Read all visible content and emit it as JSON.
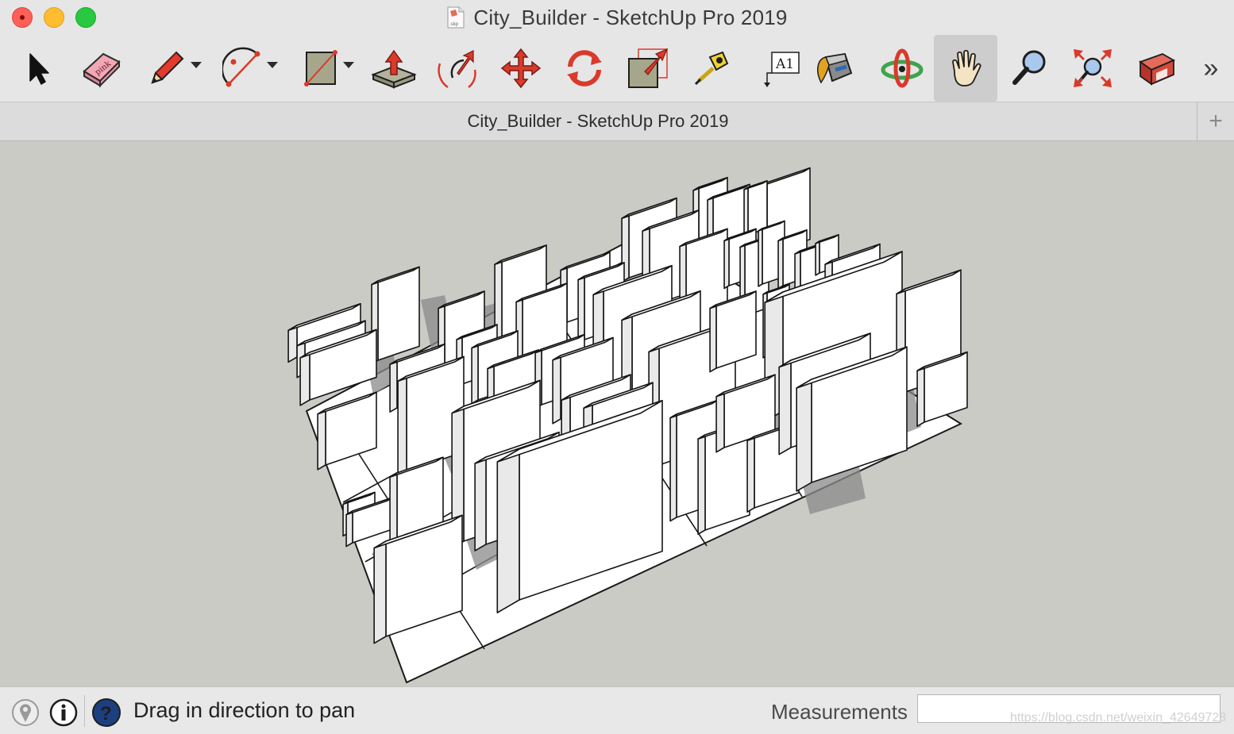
{
  "window": {
    "title": "City_Builder - SketchUp Pro 2019",
    "doc_icon_text": ".skp"
  },
  "toolbar": {
    "tools": [
      {
        "name": "select",
        "icon": "arrow-cursor-icon"
      },
      {
        "name": "eraser",
        "icon": "eraser-icon",
        "label": "pink"
      },
      {
        "name": "pencil",
        "icon": "pencil-icon",
        "has_dropdown": true
      },
      {
        "name": "arc",
        "icon": "arc-icon",
        "has_dropdown": true
      },
      {
        "name": "rectangle",
        "icon": "rectangle-icon",
        "has_dropdown": true
      },
      {
        "name": "push-pull",
        "icon": "push-pull-icon"
      },
      {
        "name": "offset",
        "icon": "offset-icon"
      },
      {
        "name": "move",
        "icon": "move-icon"
      },
      {
        "name": "rotate",
        "icon": "rotate-icon"
      },
      {
        "name": "scale",
        "icon": "scale-icon"
      },
      {
        "name": "tape-measure",
        "icon": "tape-measure-icon"
      },
      {
        "name": "text",
        "icon": "text-icon",
        "label": "A1"
      },
      {
        "name": "paint-bucket",
        "icon": "paint-bucket-icon"
      },
      {
        "name": "orbit",
        "icon": "orbit-icon"
      },
      {
        "name": "pan",
        "icon": "hand-icon",
        "active": true
      },
      {
        "name": "zoom",
        "icon": "magnifier-icon"
      },
      {
        "name": "zoom-extents",
        "icon": "zoom-extents-icon"
      },
      {
        "name": "3d-warehouse",
        "icon": "warehouse-icon"
      }
    ],
    "overflow": "»",
    "accent_red": "#d93a2b",
    "active_bg": "#cdcdcd"
  },
  "tabbar": {
    "title": "City_Builder - SketchUp Pro 2019",
    "add_label": "+"
  },
  "viewport": {
    "background": "#cbcbc6",
    "model": "city blocks",
    "face_color": "#ffffff",
    "shadow_color": "#808080"
  },
  "status": {
    "message": "Drag in direction to pan",
    "icons": [
      "geo-location-icon",
      "info-icon",
      "help-icon"
    ],
    "measurements_label": "Measurements",
    "measurements_value": ""
  },
  "watermark": "https://blog.csdn.net/weixin_42649728"
}
